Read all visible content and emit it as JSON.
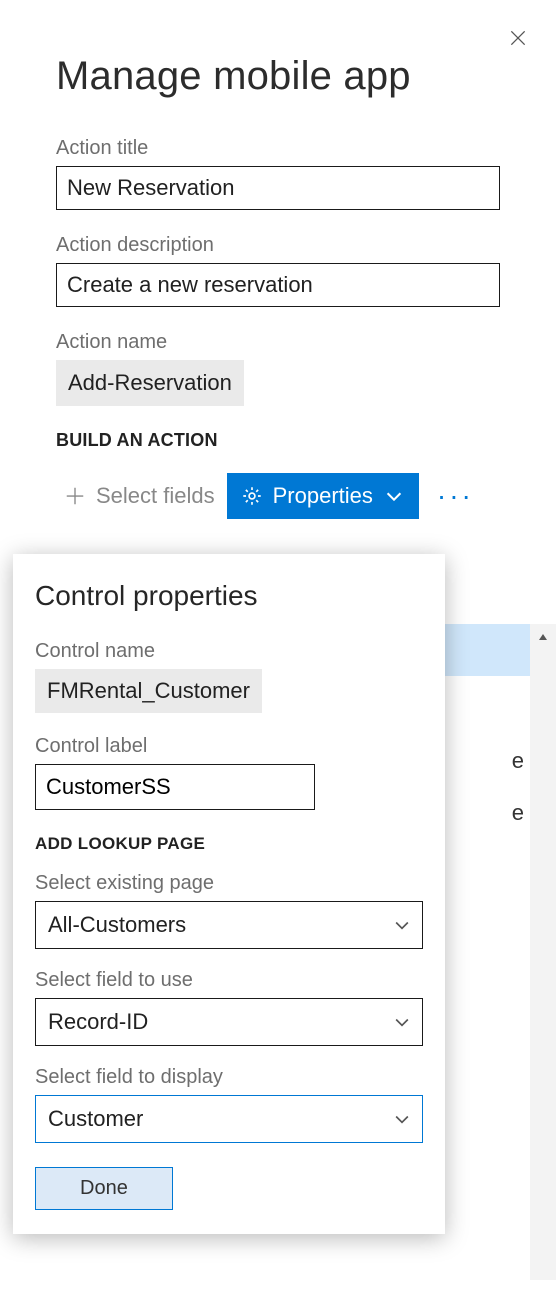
{
  "header": {
    "title": "Manage mobile app"
  },
  "fields": {
    "action_title_label": "Action title",
    "action_title_value": "New Reservation",
    "action_desc_label": "Action description",
    "action_desc_value": "Create a new reservation",
    "action_name_label": "Action name",
    "action_name_value": "Add-Reservation"
  },
  "section": {
    "build_action": "BUILD AN ACTION"
  },
  "toolbar": {
    "select_fields": "Select fields",
    "properties": "Properties"
  },
  "popover": {
    "title": "Control properties",
    "control_name_label": "Control name",
    "control_name_value": "FMRental_Customer",
    "control_label_label": "Control label",
    "control_label_value": "CustomerSS",
    "add_lookup_header": "ADD LOOKUP PAGE",
    "select_existing_label": "Select existing page",
    "select_existing_value": "All-Customers",
    "select_field_use_label": "Select field to use",
    "select_field_use_value": "Record-ID",
    "select_field_display_label": "Select field to display",
    "select_field_display_value": "Customer",
    "done": "Done"
  },
  "background": {
    "e1": "e",
    "e2": "e"
  }
}
